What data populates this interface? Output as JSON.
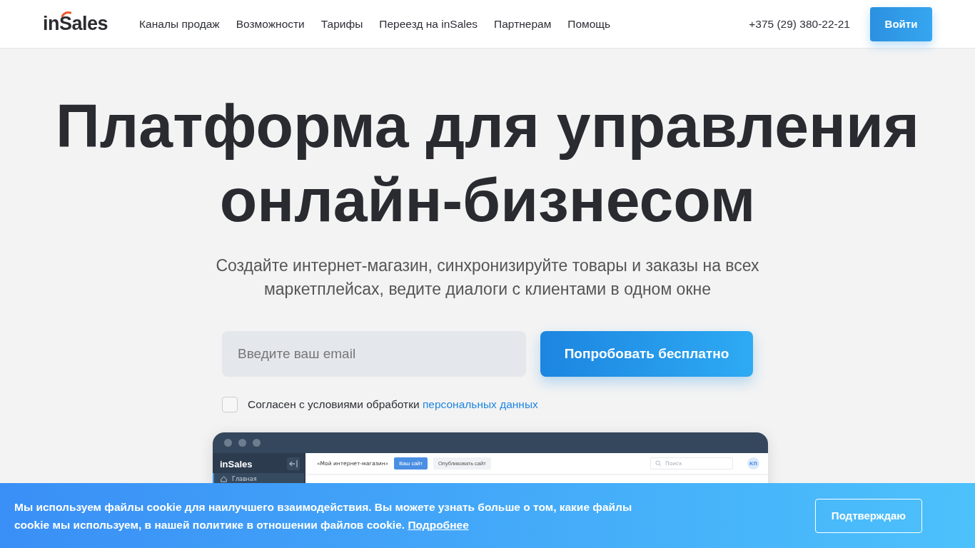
{
  "header": {
    "logo": "inSales",
    "nav": [
      "Каналы продаж",
      "Возможности",
      "Тарифы",
      "Переезд на inSales",
      "Партнерам",
      "Помощь"
    ],
    "phone": "+375 (29) 380-22-21",
    "login_button": "Войти"
  },
  "hero": {
    "title_lines": [
      "Платформа для управления",
      "онлайн-бизнесом"
    ],
    "subtitle": "Создайте интернет-магазин, синхронизируйте товары и заказы на всех маркетплейсах, ведите диалоги с клиентами в одном окне",
    "email": {
      "placeholder": "Введите ваш email"
    },
    "cta_button": "Попробовать бесплатно",
    "consent": {
      "checked": false,
      "text": "Согласен с условиями обработки",
      "link": "персональных данных"
    }
  },
  "app_preview": {
    "logo": "inSales",
    "sidebar_items": [
      {
        "label": "Главная",
        "selected": true
      }
    ],
    "store_name": "«Мой интернет-магазин»",
    "site_button": "Ваш сайт",
    "publish_button": "Опубликовать сайт",
    "search": {
      "placeholder": "Поиск"
    },
    "avatar": "КП"
  },
  "cookie_banner": {
    "text": "Мы используем файлы cookie для наилучшего взаимодействия. Вы можете узнать больше о том, какие файлы cookie мы используем, в нашей политике в отношении файлов cookie.",
    "link": "Подробнее",
    "button": "Подтверждаю"
  }
}
